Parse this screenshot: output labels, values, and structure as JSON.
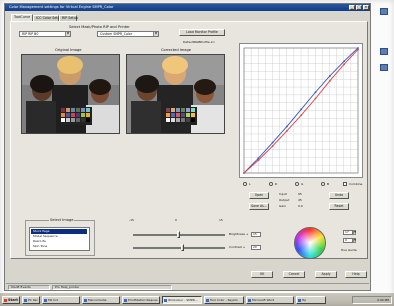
{
  "window": {
    "title": "Color Management settings for Virtual Engine SMPR_Color",
    "minimize": "_",
    "maximize": "□",
    "close": "×"
  },
  "tabs": [
    {
      "label": "ToolCurve"
    },
    {
      "label": "ICC Color Setup"
    },
    {
      "label": "RIP Setup"
    }
  ],
  "source_select": {
    "label": "Select Mask/Photo RIP and Printer",
    "rip_value": "RIP RIP B0",
    "printer_value": "Custom SMPR_Color"
  },
  "load_button": "Load Monitor Profile",
  "profile_caption": "DefaultRGBProfile.icc",
  "original_label": "Original Image",
  "corrected_label": "Corrected Image",
  "curve": {
    "channel_radios": [
      "L",
      "R",
      "G",
      "B"
    ],
    "combine_label": "Combine",
    "open_button": "Open",
    "save_as_button": "Save As...",
    "undo_button": "Undo",
    "reset_button": "Reset",
    "input_label": "Input",
    "input_value": "95",
    "output_label": "Output",
    "output_value": "45",
    "gain_label": "Gain",
    "gain_value": "0.0"
  },
  "select_image": {
    "label": "Select Image",
    "items": [
      "Stock Page",
      "Model Sequence",
      "Real Life",
      "Skin Tone"
    ]
  },
  "sliders": {
    "scale_min": "-15",
    "scale_mid": "0",
    "scale_max": "15",
    "brightness_label": "Brightness +",
    "brightness_value": "15",
    "contrast_label": "Contrast +",
    "contrast_value": "20"
  },
  "color_wheel": {
    "hue_label": "Hue Guide",
    "field1_value": "17",
    "field2_value": "0"
  },
  "buttons": {
    "ok": "OK",
    "cancel": "Cancel",
    "apply": "Apply",
    "help": "Help"
  },
  "statusbar": {
    "left": "Ulsoft Events",
    "right": "Pro Help_printer"
  },
  "taskbar": {
    "start": "Start",
    "items": [
      "PC Rel",
      "Mk Ind",
      "Macromedia",
      "PrintStation Reques",
      "WinColour - SMPR...",
      "Tool Color - Keystn",
      "Microsoft Word",
      "Hp"
    ],
    "clock": "4:30 PM"
  },
  "desktop_icons": [
    "",
    "",
    ""
  ],
  "chart_data": {
    "type": "line",
    "xlim": [
      0,
      255
    ],
    "ylim": [
      0,
      255
    ],
    "grid": true,
    "series": [
      {
        "color": "#3355cc",
        "x": [
          0,
          32,
          64,
          96,
          128,
          160,
          192,
          224,
          255
        ],
        "y": [
          0,
          30,
          62,
          95,
          130,
          165,
          198,
          228,
          255
        ]
      },
      {
        "color": "#e04040",
        "x": [
          0,
          32,
          64,
          96,
          128,
          160,
          192,
          224,
          255
        ],
        "y": [
          0,
          26,
          55,
          86,
          118,
          152,
          188,
          222,
          252
        ]
      }
    ]
  }
}
